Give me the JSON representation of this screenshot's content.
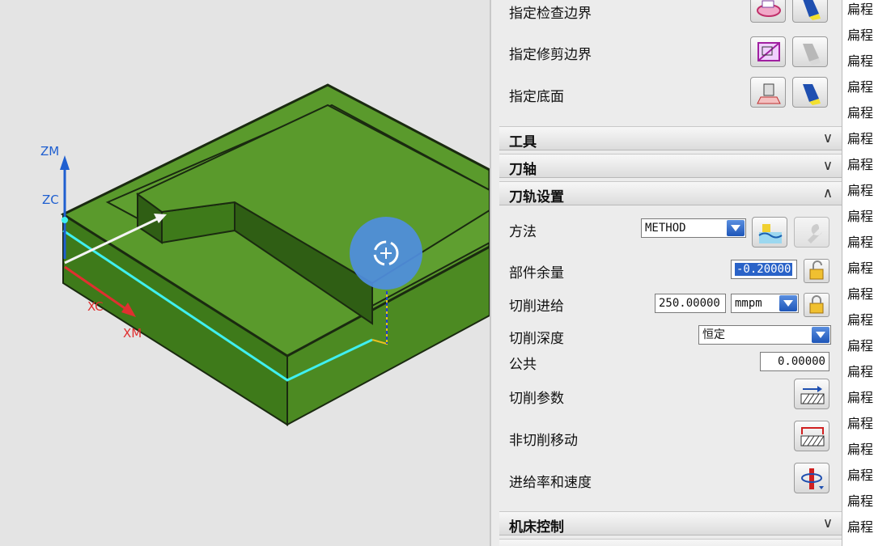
{
  "viewport": {
    "axis_labels": {
      "zm": "ZM",
      "zc": "ZC",
      "xc": "XC",
      "xm": "XM"
    },
    "colors": {
      "part_top": "#5a9a2c",
      "part_side": "#3e7a1a",
      "toolpath": "#3ff0f0",
      "zm_axis": "#1f5fd0",
      "xm_axis": "#e03030"
    }
  },
  "panel": {
    "geometry_rows": [
      {
        "label": "指定检查边界",
        "icon1": "check-boundary-icon",
        "icon2": "flashlight-icon"
      },
      {
        "label": "指定修剪边界",
        "icon1": "trim-boundary-icon",
        "icon2": "flashlight-disabled-icon"
      },
      {
        "label": "指定底面",
        "icon1": "floor-icon",
        "icon2": "flashlight-icon"
      }
    ],
    "sections": {
      "tools": "工具",
      "tool_axis": "刀轴",
      "path_settings": "刀轨设置",
      "machine_control": "机床控制"
    },
    "path_settings": {
      "method_label": "方法",
      "method_value": "METHOD",
      "stock_label": "部件余量",
      "stock_value": "-0.20000",
      "feed_label": "切削进给",
      "feed_value": "250.00000",
      "feed_unit": "mmpm",
      "depth_label": "切削深度",
      "depth_value": "恒定",
      "common_label": "公共",
      "common_value": "0.00000",
      "cut_params_label": "切削参数",
      "non_cut_label": "非切削移动",
      "feeds_speeds_label": "进给率和速度"
    }
  },
  "strip": {
    "items": [
      "扁程",
      "扁程",
      "扁程",
      "扁程",
      "扁程",
      "扁程",
      "扁程",
      "扁程",
      "扁程",
      "扁程",
      "扁程",
      "扁程",
      "扁程",
      "扁程",
      "扁程",
      "扁程",
      "扁程",
      "扁程",
      "扁程",
      "扁程",
      "扁程"
    ]
  }
}
